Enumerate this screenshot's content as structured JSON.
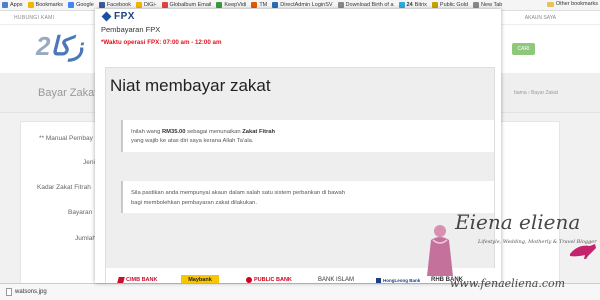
{
  "bookmarks": {
    "items": [
      {
        "label": "Apps",
        "icon": "apps-grid-icon",
        "color": "#4a7dd8"
      },
      {
        "label": "Bookmarks",
        "icon": "star-icon",
        "color": "#f2b600"
      },
      {
        "label": "Google",
        "icon": "google-icon",
        "color": "#4285f4"
      },
      {
        "label": "Facebook",
        "icon": "facebook-icon",
        "color": "#3b5998"
      },
      {
        "label": "DiGi-",
        "icon": "digi-icon",
        "color": "#f5b400"
      },
      {
        "label": "Globalbum Email",
        "icon": "mail-icon",
        "color": "#d44"
      },
      {
        "label": "KeepVidi",
        "icon": "keepvid-icon",
        "color": "#3a9a3a"
      },
      {
        "label": "TM",
        "icon": "tm-icon",
        "color": "#e05a00"
      },
      {
        "label": "DirectAdmin LoginSV",
        "icon": "directadmin-icon",
        "color": "#2a6ab8"
      },
      {
        "label": "Download Birth of a",
        "icon": "page-icon",
        "color": "#888"
      },
      {
        "label": "Bitrix",
        "icon": "bitrix-icon",
        "color": "#2fa8e0"
      },
      {
        "label": "Public Gold",
        "icon": "publicgold-icon",
        "color": "#c9a100"
      },
      {
        "label": "New Tab",
        "icon": "page-icon",
        "color": "#888"
      }
    ],
    "bitrix_prefix": "24",
    "other_bookmarks": "Other bookmarks"
  },
  "page": {
    "hubungi": "HUBUNGI KAMI",
    "akaun": "AKAUN SAYA",
    "logo_text": "زكا",
    "logo_suffix": "2",
    "cari_button": "CARI",
    "title": "Bayar Zakat",
    "breadcrumb": "Utama  ›  Bayar Zakat",
    "breadcrumb_visible": "bama  ›  Bayar Zakat",
    "form_labels": {
      "manual": "** Manual Pembay",
      "jenis": "Jeni",
      "kadar": "Kadar Zakat Fitrah",
      "bayaran": "Bayaran",
      "jumlah": "Jumlah"
    }
  },
  "modal": {
    "brand": "FPX",
    "title": "Pembayaran FPX",
    "warning": "*Waktu operasi FPX: 07:00 am - 12:00 am",
    "heading": "Niat membayar zakat",
    "niat": {
      "prefix": "Inilah wang ",
      "amount": "RM35.00",
      "middle": " sebagai menunaikan ",
      "zakat_type": "Zakat Fitrah",
      "suffix": "yang wajib ke atas diri saya kerana Allah Ta'ala."
    },
    "sila_line1": "Sila pastikan anda mempunyai akaun dalam salah satu sistem perbankan di bawah",
    "sila_line2": "bagi membolehkan pembayaran zakat dilakukan.",
    "banks": [
      {
        "name": "CIMB BANK",
        "icon": "cimb-icon"
      },
      {
        "name": "Maybank",
        "icon": "maybank-icon"
      },
      {
        "name": "PUBLIC BANK",
        "icon": "publicbank-icon"
      },
      {
        "name": "BANK ISLAM",
        "icon": "bankislam-icon"
      },
      {
        "name": "HongLeong Bank",
        "icon": "hongleong-icon"
      },
      {
        "name": "RHB BANK",
        "icon": "rhb-icon"
      }
    ]
  },
  "statusbar": {
    "download_file": "watsons.jpg"
  },
  "watermark": {
    "line1": "Eiena eliena",
    "line2": "Lifestyle, Wedding, Motherly & Travel Blogger",
    "line3": "www.fenaeliena.com"
  }
}
